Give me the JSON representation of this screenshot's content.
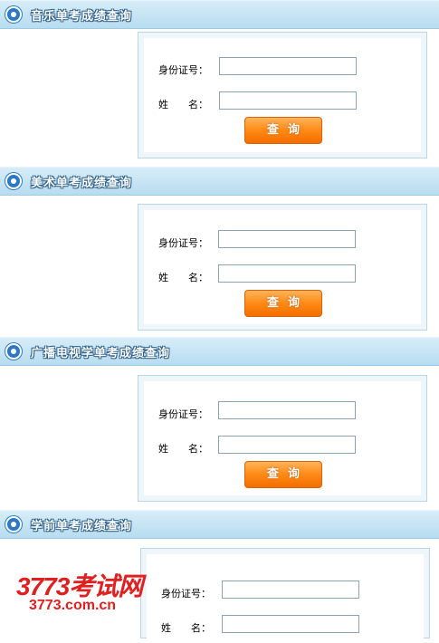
{
  "sections": [
    {
      "title": "音乐单考成绩查询",
      "id_label": "身份证号：",
      "name_label": "姓　　名：",
      "button": "查询"
    },
    {
      "title": "美术单考成绩查询",
      "id_label": "身份证号：",
      "name_label": "姓　　名：",
      "button": "查询"
    },
    {
      "title": "广播电视学单考成绩查询",
      "id_label": "身份证号：",
      "name_label": "姓　　名：",
      "button": "查询"
    },
    {
      "title": "学前单考成绩查询",
      "id_label": "身份证号：",
      "name_label": "姓　　名：",
      "button": ""
    }
  ],
  "watermark": {
    "line1": "3773考试网",
    "line2": "3773.com.cn"
  }
}
